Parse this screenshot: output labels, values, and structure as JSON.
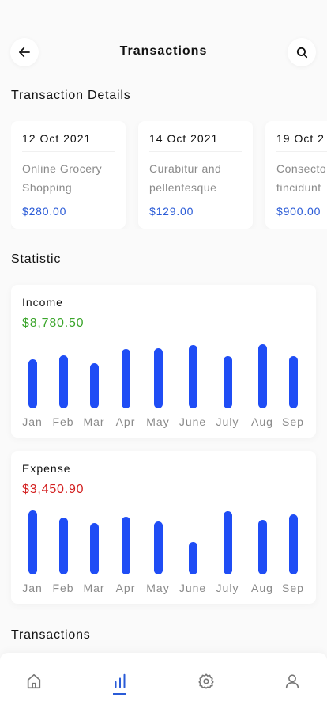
{
  "header": {
    "title": "Transactions",
    "back_icon": "arrow-left-icon",
    "search_icon": "search-icon"
  },
  "details": {
    "title": "Transaction Details",
    "cards": [
      {
        "date": "12 Oct 2021",
        "description": "Online Grocery\nShopping",
        "amount": "$280.00"
      },
      {
        "date": "14 Oct 2021",
        "description": "Curabitur and\npellentesque",
        "amount": "$129.00"
      },
      {
        "date": "19 Oct 2",
        "description": "Consecto\ntincidunt",
        "amount": "$900.00"
      }
    ]
  },
  "statistic": {
    "title": "Statistic",
    "months": [
      "Jan",
      "Feb",
      "Mar",
      "Apr",
      "May",
      "June",
      "July",
      "Aug",
      "Sep"
    ],
    "income": {
      "label": "Income",
      "value": "$8,780.50",
      "color": "#3aa52a"
    },
    "expense": {
      "label": "Expense",
      "value": "$3,450.90",
      "color": "#d32020"
    }
  },
  "transactions": {
    "title": "Transactions"
  },
  "nav": {
    "items": [
      "home-icon",
      "chart-icon",
      "settings-icon",
      "profile-icon"
    ],
    "active": "chart-icon",
    "accent": "#2a5bd7"
  },
  "chart_data": [
    {
      "type": "bar",
      "title": "Income",
      "categories": [
        "Jan",
        "Feb",
        "Mar",
        "Apr",
        "May",
        "June",
        "July",
        "Aug",
        "Sep"
      ],
      "values": [
        62,
        67,
        57,
        75,
        76,
        80,
        66,
        81,
        66
      ],
      "ylim": [
        0,
        100
      ]
    },
    {
      "type": "bar",
      "title": "Expense",
      "categories": [
        "Jan",
        "Feb",
        "Mar",
        "Apr",
        "May",
        "June",
        "July",
        "Aug",
        "Sep"
      ],
      "values": [
        81,
        72,
        65,
        73,
        67,
        41,
        80,
        69,
        76
      ],
      "ylim": [
        0,
        100
      ]
    }
  ]
}
